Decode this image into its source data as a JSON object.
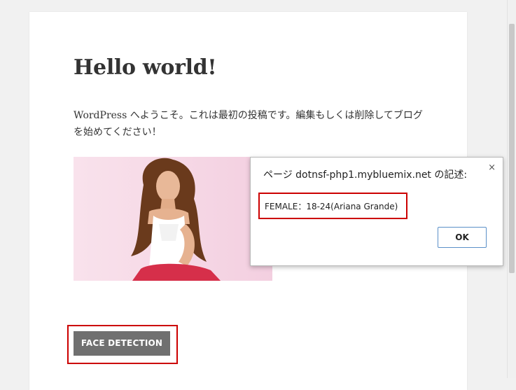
{
  "post": {
    "title": "Hello world!",
    "body": "WordPress へようこそ。これは最初の投稿です。編集もしくは削除してブログを始めてください！",
    "button_label": "FACE DETECTION"
  },
  "dialog": {
    "title": "ページ dotnsf-php1.mybluemix.net の記述:",
    "close_symbol": "×",
    "message": "FEMALE：18-24(Ariana Grande)",
    "ok_label": "OK"
  },
  "colors": {
    "highlight": "#cc0000",
    "button_bg": "#707070",
    "photo_bg": "#f6d7e6"
  }
}
